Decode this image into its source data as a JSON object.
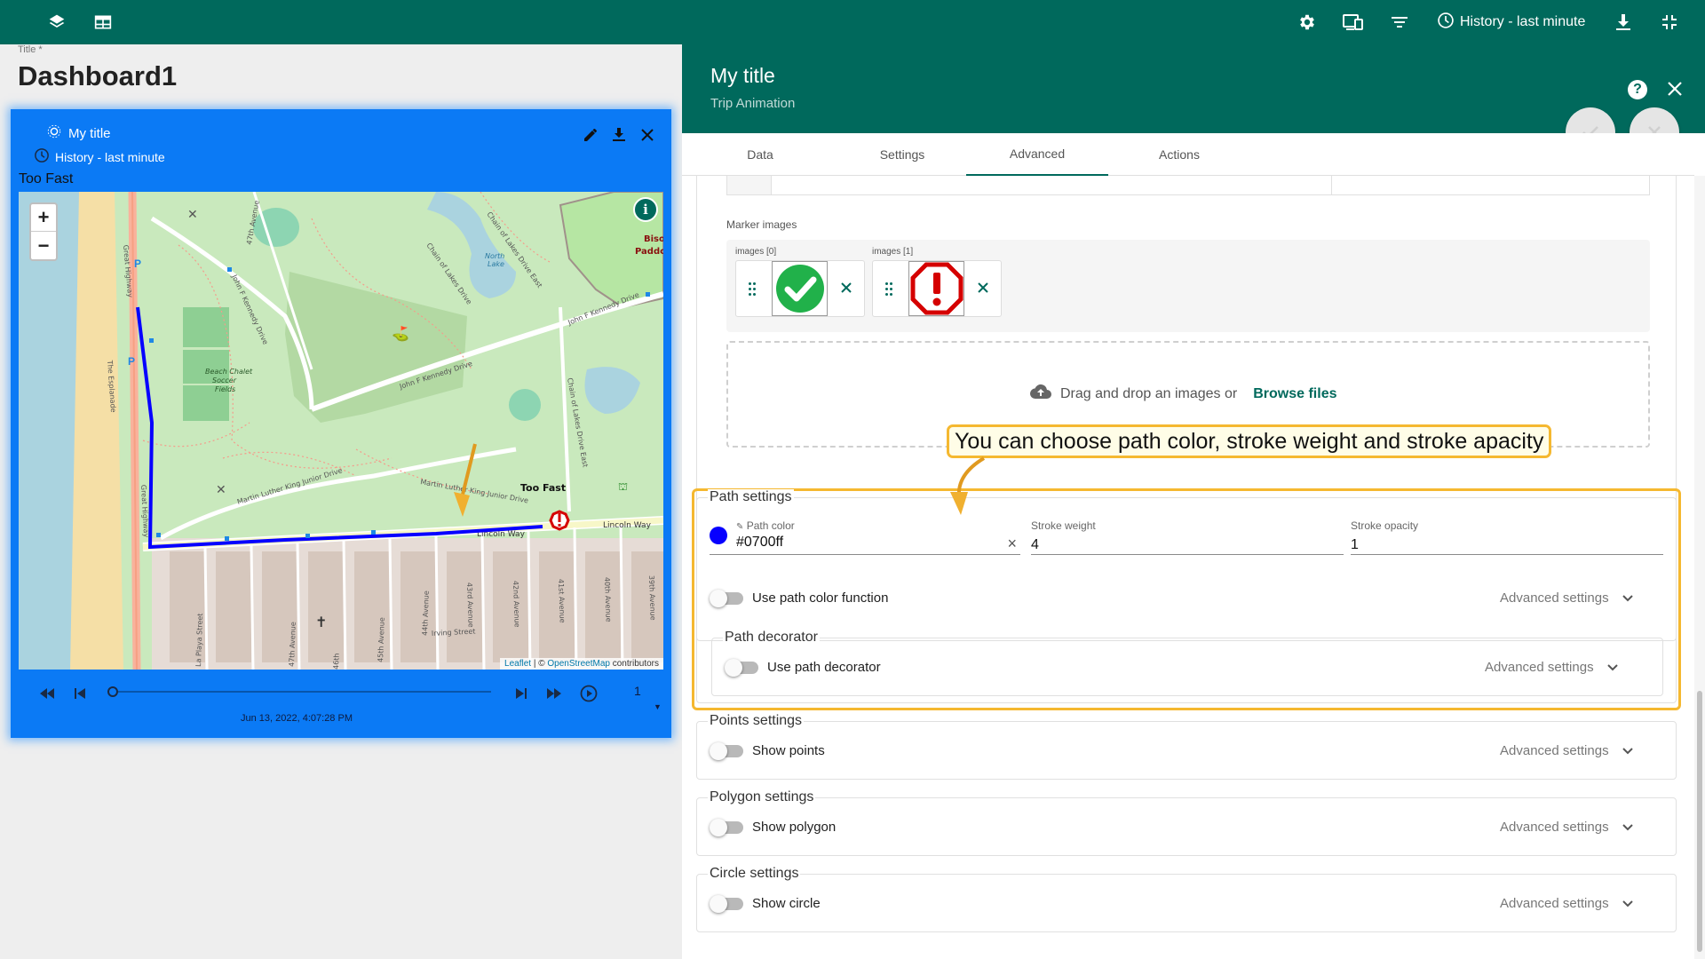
{
  "toolbar": {
    "history_label": "History - last minute",
    "icons": [
      "layers-icon",
      "dashboard-layout-icon",
      "settings-icon",
      "devices-icon",
      "filter-icon",
      "clock-icon",
      "download-icon",
      "fullscreen-exit-icon"
    ]
  },
  "dashboard": {
    "title_label": "Title *",
    "title": "Dashboard1"
  },
  "widget": {
    "title": "My title",
    "timewindow": "History - last minute",
    "status_label": "Too Fast",
    "map": {
      "zoom_in": "+",
      "zoom_out": "−",
      "marker_label": "Too Fast",
      "attribution_leaflet": "Leaflet",
      "attribution_sep": " | © ",
      "attribution_osm": "OpenStreetMap",
      "attribution_tail": " contributors",
      "streets": [
        "Great Highway",
        "The Esplanade",
        "John F Kennedy Drive",
        "Martin Luther King Junior Drive",
        "Lincoln Way",
        "Chain of Lakes Drive East",
        "Irving Street",
        "47th Avenue",
        "45th Avenue",
        "44th Avenue",
        "43rd Avenue",
        "42nd Avenue",
        "41st Avenue",
        "40th Avenue",
        "39th Avenue",
        "La Playa Street",
        "46th",
        "Beach Chalet Soccer Fields",
        "North Lake",
        "Bison Paddock"
      ],
      "path_color": "#0700ff"
    },
    "player": {
      "timestamp": "Jun 13, 2022, 4:07:28 PM",
      "speed": "1"
    }
  },
  "panel": {
    "title": "My title",
    "subtitle": "Trip Animation",
    "tabs": [
      {
        "label": "Data"
      },
      {
        "label": "Settings"
      },
      {
        "label": "Advanced"
      },
      {
        "label": "Actions"
      }
    ],
    "active_tab": "Advanced",
    "marker_images": {
      "label": "Marker images",
      "items": [
        {
          "label": "images [0]",
          "icon": "green-check-icon"
        },
        {
          "label": "images [1]",
          "icon": "red-alert-octagon-icon"
        }
      ],
      "drop_text": "Drag and drop an images or",
      "browse": "Browse files"
    },
    "callout": "You can choose path color, stroke weight and stroke apacity",
    "path_settings": {
      "legend": "Path settings",
      "color_label": "Path color",
      "color_value": "#0700ff",
      "clear": "×",
      "weight_label": "Stroke weight",
      "weight_value": "4",
      "opacity_label": "Stroke opacity",
      "opacity_value": "1",
      "color_function_toggle": "Use path color function",
      "advanced": "Advanced settings",
      "decorator": {
        "legend": "Path decorator",
        "toggle": "Use path decorator",
        "advanced": "Advanced settings"
      }
    },
    "points_settings": {
      "legend": "Points settings",
      "toggle": "Show points",
      "advanced": "Advanced settings"
    },
    "polygon_settings": {
      "legend": "Polygon settings",
      "toggle": "Show polygon",
      "advanced": "Advanced settings"
    },
    "circle_settings": {
      "legend": "Circle settings",
      "toggle": "Show circle",
      "advanced": "Advanced settings"
    }
  },
  "colors": {
    "primary": "#00695c",
    "widget_bg": "#0b7af5",
    "highlight": "#f5b830",
    "path": "#0700ff"
  }
}
